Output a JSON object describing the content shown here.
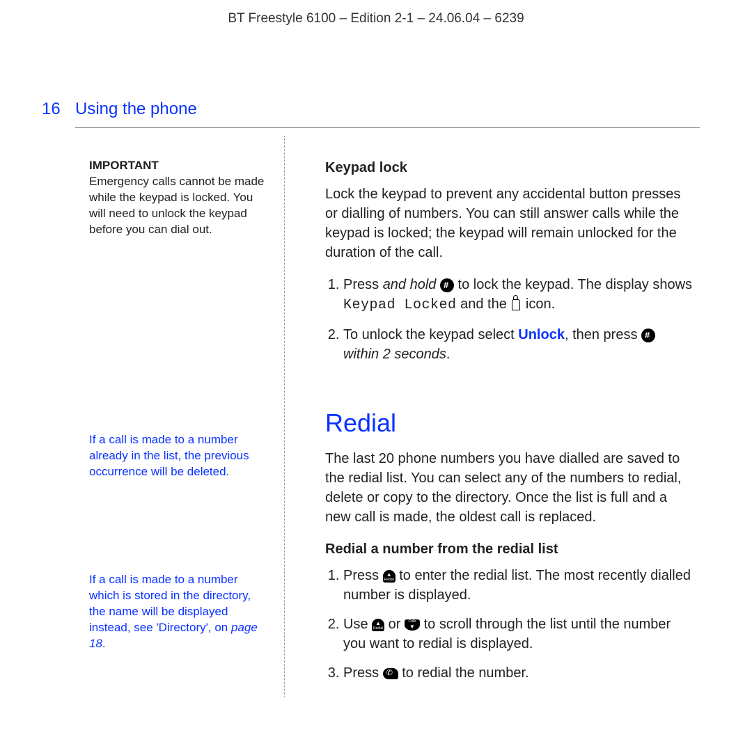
{
  "doc_header": "BT Freestyle 6100 – Edition 2-1 – 24.06.04 – 6239",
  "page_number": "16",
  "section_title": "Using the phone",
  "sidebar": {
    "important_label": "IMPORTANT",
    "important_text": "Emergency calls cannot be made while the keypad is locked. You will need to unlock the keypad before you can dial out.",
    "note2": "If a call is made to a number already in the list, the previous occurrence will be deleted.",
    "note3_pre": "If a call is made to a number which is stored in the directory, the name will be displayed instead, see 'Directory', on ",
    "note3_page": "page 18",
    "note3_post": "."
  },
  "main": {
    "keypad_heading": "Keypad lock",
    "keypad_intro": "Lock the keypad to prevent any accidental button presses or dialling of numbers. You can still answer calls while the keypad is locked; the keypad will remain unlocked for the duration of the call.",
    "step1_a": "Press ",
    "step1_b": "and hold",
    "step1_c": " to lock the keypad. The display shows ",
    "step1_mono": "Keypad Locked",
    "step1_d": " and the ",
    "step1_e": " icon.",
    "step2_a": "To unlock the keypad select ",
    "step2_unlock": "Unlock",
    "step2_b": ", then press ",
    "step2_c": "within 2 seconds",
    "step2_d": ".",
    "redial_heading": "Redial",
    "redial_intro": "The last 20 phone numbers you have dialled are saved to the redial list. You can select any of the numbers to redial, delete or copy to the directory. Once the list is full and a new call is made, the oldest call is replaced.",
    "redial_sub": "Redial a number from the redial list",
    "r1_a": "Press ",
    "r1_b": " to enter the redial list. The most recently dialled number is displayed.",
    "r2_a": "Use ",
    "r2_b": " or ",
    "r2_c": " to scroll through the list until the number you want to redial is displayed.",
    "r3_a": "Press ",
    "r3_b": " to redial the number.",
    "icon_up_sub": "Redial",
    "icon_down_sub": "Calls"
  }
}
